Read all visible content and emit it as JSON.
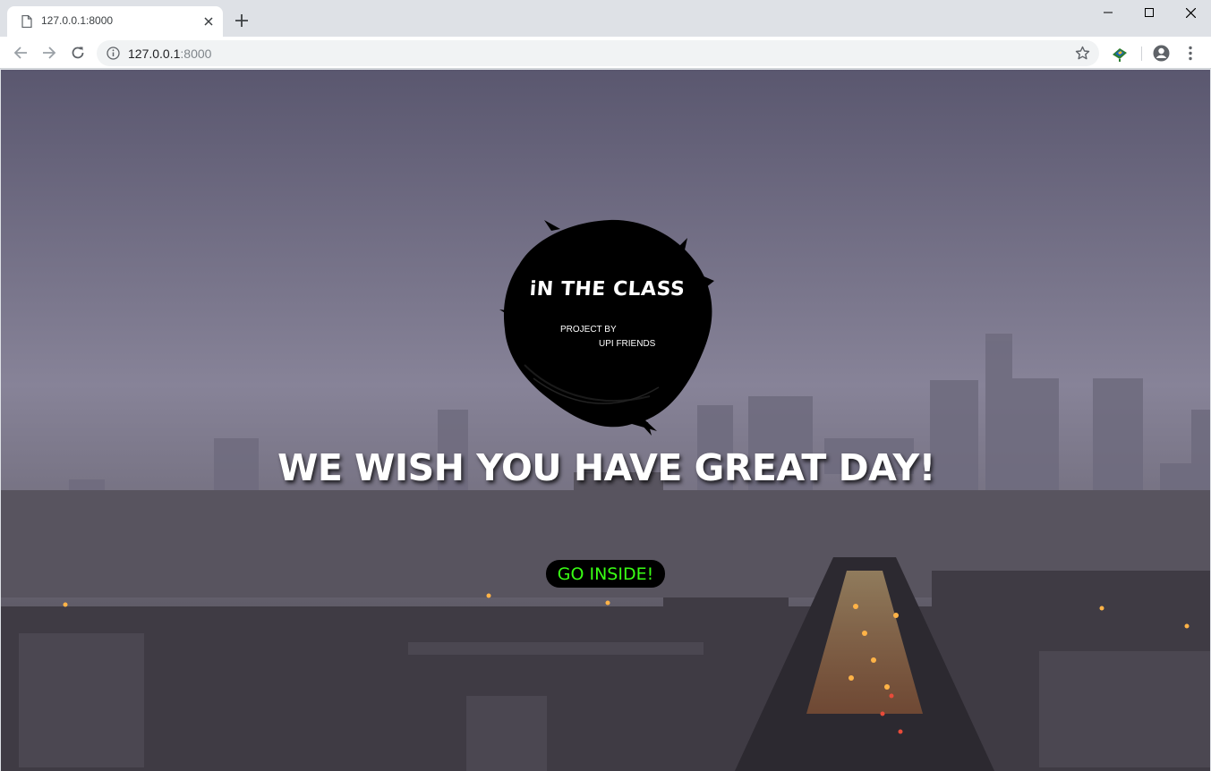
{
  "browser": {
    "tab_title": "127.0.0.1:8000",
    "url_host": "127.0.0.1",
    "url_port": ":8000",
    "icons": {
      "favicon": "page-icon",
      "tab_close": "close-icon",
      "new_tab": "plus-icon",
      "back": "arrow-left-icon",
      "forward": "arrow-right-icon",
      "reload": "reload-icon",
      "site_info": "info-icon",
      "bookmark": "star-icon",
      "extension": "extension-icon",
      "profile": "profile-icon",
      "menu": "more-vert-icon",
      "minimize": "minimize-icon",
      "maximize": "maximize-icon",
      "window_close": "close-icon"
    }
  },
  "page": {
    "logo": {
      "title": "iN THE CLASS",
      "project_by": "PROJECT BY",
      "team": "UPI FRIENDS"
    },
    "headline": "WE WISH YOU HAVE GREAT DAY!",
    "cta_label": "GO INSIDE!",
    "colors": {
      "cta_text": "#39ff14",
      "cta_bg": "#000000",
      "headline": "#ffffff"
    }
  }
}
